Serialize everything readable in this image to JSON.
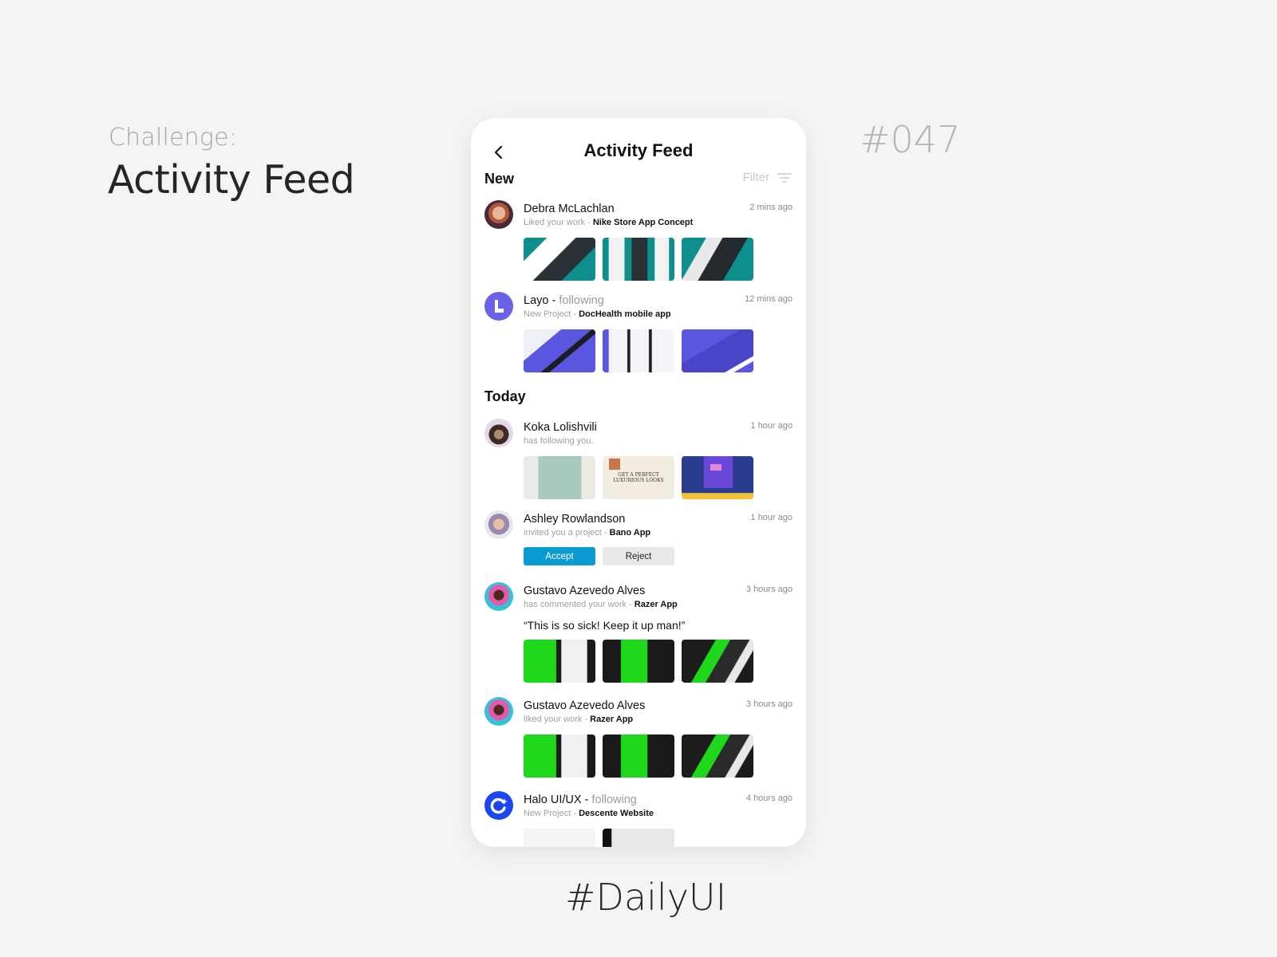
{
  "presentation": {
    "challenge_label": "Challenge:",
    "challenge_title": "Activity Feed",
    "challenge_number": "#047",
    "tag": "#DailyUI"
  },
  "header": {
    "back_icon": "chevron-left-icon",
    "title": "Activity Feed",
    "filter_label": "Filter",
    "filter_icon": "filter-lines-icon"
  },
  "sections": {
    "new": "New",
    "today": "Today"
  },
  "feed": [
    {
      "name": "Debra McLachlan",
      "following": "",
      "action": "Liked your work - ",
      "target": "Nike Store App Concept",
      "time": "2 mins ago",
      "thumb_theme": "teal"
    },
    {
      "name": "Layo",
      "following": "following",
      "action": "New Project - ",
      "target": "DocHealth mobile app",
      "time": "12 mins ago",
      "thumb_theme": "purple"
    },
    {
      "name": "Koka Lolishvili",
      "following": "",
      "action": "has following you.",
      "target": "",
      "time": "1 hour ago",
      "thumb_theme": "mixed"
    },
    {
      "name": "Ashley Rowlandson",
      "following": "",
      "action": "invited you a project - ",
      "target": "Bano App",
      "time": "1 hour ago",
      "accept_label": "Accept",
      "reject_label": "Reject"
    },
    {
      "name": "Gustavo Azevedo Alves",
      "following": "",
      "action": "has commented your work - ",
      "target": "Razer App",
      "time": "3 hours ago",
      "comment": "“This is so sick! Keep it up man!”",
      "thumb_theme": "green"
    },
    {
      "name": "Gustavo Azevedo Alves",
      "following": "",
      "action": "liked your work - ",
      "target": "Razer App",
      "time": "3 hours ago",
      "thumb_theme": "green"
    },
    {
      "name": "Halo UI/UX",
      "following": "following",
      "action": "New Project - ",
      "target": "Descente Website",
      "time": "4 hours ago"
    }
  ],
  "thumb_texts": {
    "koka_2": "GET A PERFECT LUXURIOUS LOOKS"
  },
  "colors": {
    "accent": "#0a9bd0",
    "reject_bg": "#e8e8e8",
    "layo_avatar": "#6b63e6",
    "halo_avatar": "#1a47f0",
    "razer_green": "#1fd81c",
    "nike_teal": "#0f8e8e",
    "doc_purple": "#5b56e0"
  }
}
